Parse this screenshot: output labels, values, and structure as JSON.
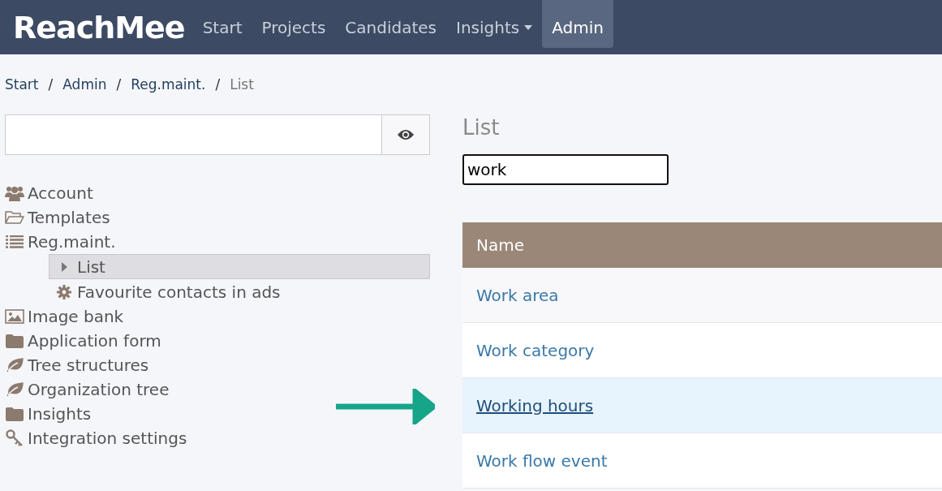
{
  "navbar": {
    "logo": "ReachMee",
    "items": [
      {
        "label": "Start",
        "selected": false,
        "has_menu": false
      },
      {
        "label": "Projects",
        "selected": false,
        "has_menu": false
      },
      {
        "label": "Candidates",
        "selected": false,
        "has_menu": false
      },
      {
        "label": "Insights",
        "selected": false,
        "has_menu": true
      },
      {
        "label": "Admin",
        "selected": true,
        "has_menu": false
      }
    ]
  },
  "breadcrumb": [
    {
      "label": "Start",
      "separator": "/",
      "current": false
    },
    {
      "label": "Admin",
      "separator": "/",
      "current": false
    },
    {
      "label": "Reg.maint.",
      "separator": "/",
      "current": false
    },
    {
      "label": "List",
      "current": true
    }
  ],
  "sidebar": {
    "items": [
      {
        "label": "Account",
        "selected": false
      },
      {
        "label": "Templates",
        "selected": false
      },
      {
        "label": "Reg.maint.",
        "selected": false,
        "children": [
          {
            "label": "List",
            "selected": true
          },
          {
            "label": "Favourite contacts in ads",
            "selected": false
          }
        ]
      },
      {
        "label": "Image bank",
        "selected": false
      },
      {
        "label": "Application form",
        "selected": false
      },
      {
        "label": "Tree structures",
        "selected": false
      },
      {
        "label": "Organization tree",
        "selected": false
      },
      {
        "label": "Insights",
        "selected": false
      },
      {
        "label": "Integration settings",
        "selected": false
      }
    ]
  },
  "content": {
    "title": "List",
    "filter": {
      "value": "work"
    },
    "table": {
      "columns": [
        "Name"
      ],
      "rows": [
        {
          "name": "Work area",
          "hovered": false
        },
        {
          "name": "Work category",
          "hovered": false
        },
        {
          "name": "Working hours",
          "hovered": true
        },
        {
          "name": "Work flow event",
          "hovered": false
        }
      ]
    }
  }
}
